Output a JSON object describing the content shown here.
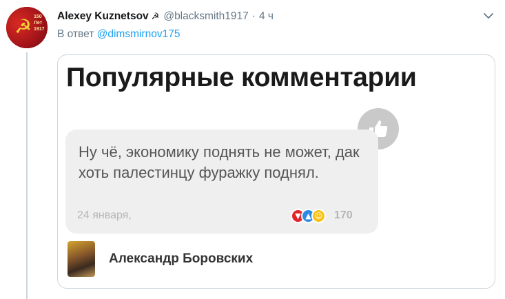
{
  "tweet": {
    "author_name": "Alexey Kuznetsov",
    "handle": "@blacksmith1917",
    "separator": "·",
    "time": "4 ч",
    "reply_prefix": "В ответ",
    "reply_mention": "@dimsmirnov175",
    "avatar_text": "150\nЛет\n1917"
  },
  "card": {
    "title": "Популярные комментарии",
    "comment_text": "Ну чё, экономику поднять не может, дак хоть палестинцу фуражку поднял.",
    "comment_date": "24 января,",
    "reaction_count": "170",
    "author_name": "Александр Боровских"
  },
  "icons": {
    "author_badge": "hammer-sickle-icon",
    "menu": "chevron-down-icon",
    "like_badge": "thumbs-up-icon",
    "reactions": [
      "dislike-icon",
      "like-icon",
      "smile-icon"
    ]
  },
  "colors": {
    "link": "#1da1f2",
    "secondary_text": "#657786",
    "avatar_red": "#b01c1c",
    "reaction_dislike": "#e2252b",
    "reaction_like": "#2b8ae6",
    "reaction_smile": "#f6c21a"
  }
}
